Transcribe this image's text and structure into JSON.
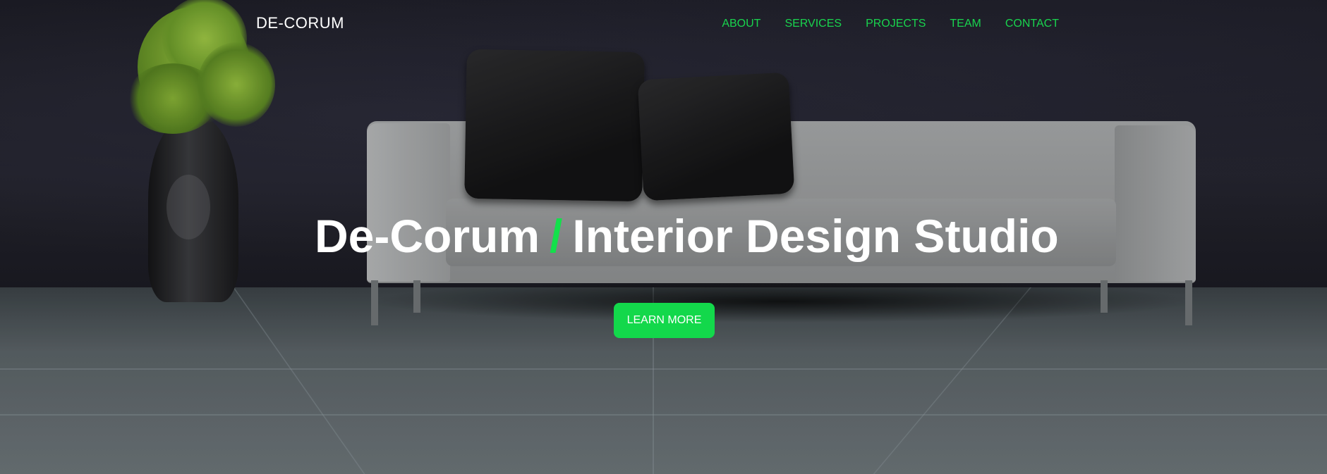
{
  "header": {
    "brand": "DE-CORUM",
    "nav": [
      "ABOUT",
      "SERVICES",
      "PROJECTS",
      "TEAM",
      "CONTACT"
    ]
  },
  "hero": {
    "title_strong": "De-Corum",
    "title_separator": "/",
    "title_rest": "Interior Design Studio",
    "cta_label": "LEARN MORE"
  },
  "colors": {
    "accent": "#13d84b",
    "nav_text": "#19d44e",
    "title_text": "#ffffff"
  }
}
